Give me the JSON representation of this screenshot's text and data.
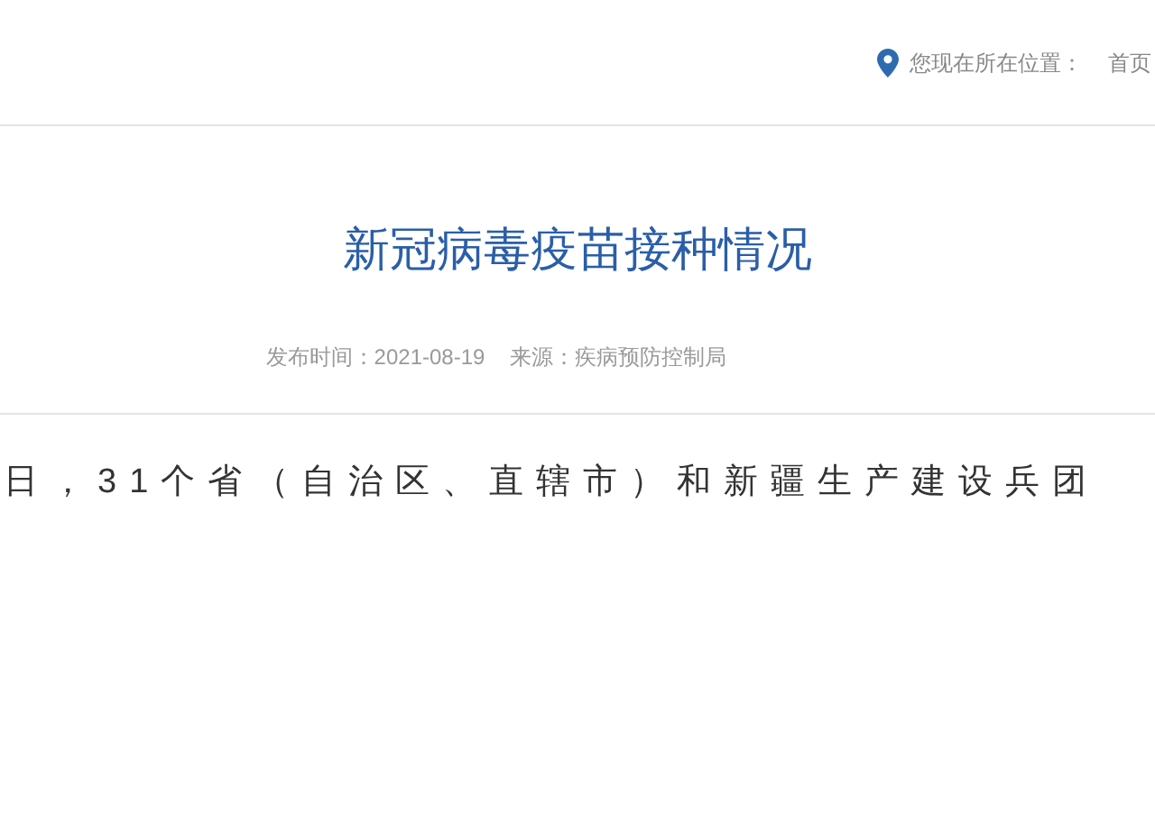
{
  "breadcrumb": {
    "label": "您现在所在位置：",
    "items": [
      "首页"
    ]
  },
  "article": {
    "title": "新冠病毒疫苗接种情况",
    "published": "发布时间：2021-08-19",
    "source": "来源：疾病预防控制局",
    "paragraph": "日，31个省（自治区、直辖市）和新疆生产建设兵团"
  }
}
